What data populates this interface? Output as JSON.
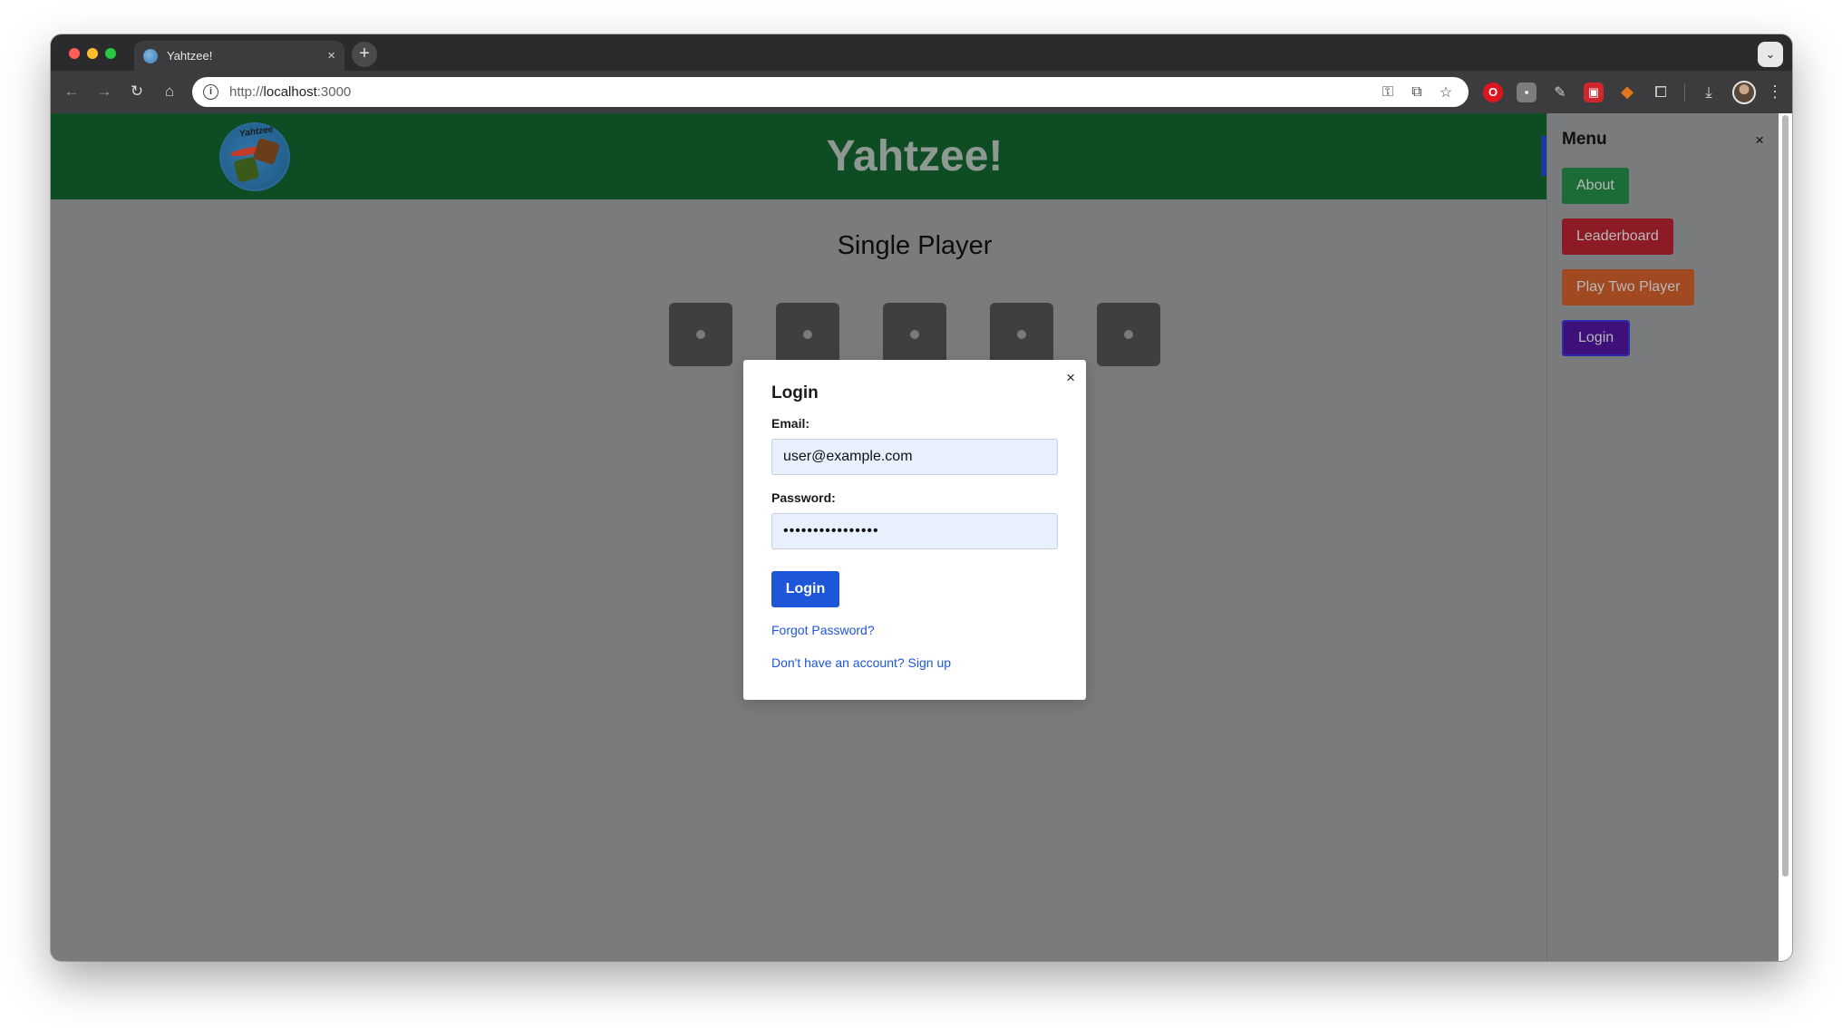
{
  "browser": {
    "tab_title": "Yahtzee!",
    "tab_close": "×",
    "new_tab": "+",
    "tab_menu": "⌄",
    "url_scheme": "http://",
    "url_host": "localhost",
    "url_port": ":3000",
    "nav_back": "←",
    "nav_forward": "→",
    "nav_reload": "↻",
    "nav_home": "⌂",
    "info": "i"
  },
  "header": {
    "title": "Yahtzee!",
    "logo_text": "Yahtzee"
  },
  "game": {
    "mode_title": "Single Player",
    "dice_count": 5
  },
  "login_modal": {
    "title": "Login",
    "close": "×",
    "email_label": "Email:",
    "email_value": "user@example.com",
    "password_label": "Password:",
    "password_value": "••••••••••••••••",
    "submit_label": "Login",
    "forgot_link": "Forgot Password?",
    "signup_link": "Don't have an account? Sign up"
  },
  "side_menu": {
    "title": "Menu",
    "close": "×",
    "items": [
      {
        "label": "About",
        "color": "#1b6c36"
      },
      {
        "label": "Leaderboard",
        "color": "#8c1b26"
      },
      {
        "label": "Play Two Player",
        "color": "#a14a22"
      },
      {
        "label": "Login",
        "color": "#3e107a"
      }
    ]
  },
  "colors": {
    "header_bg": "#0e4d24",
    "overlay_bg": "#7a7b7c",
    "primary_button": "#1d56d8"
  }
}
